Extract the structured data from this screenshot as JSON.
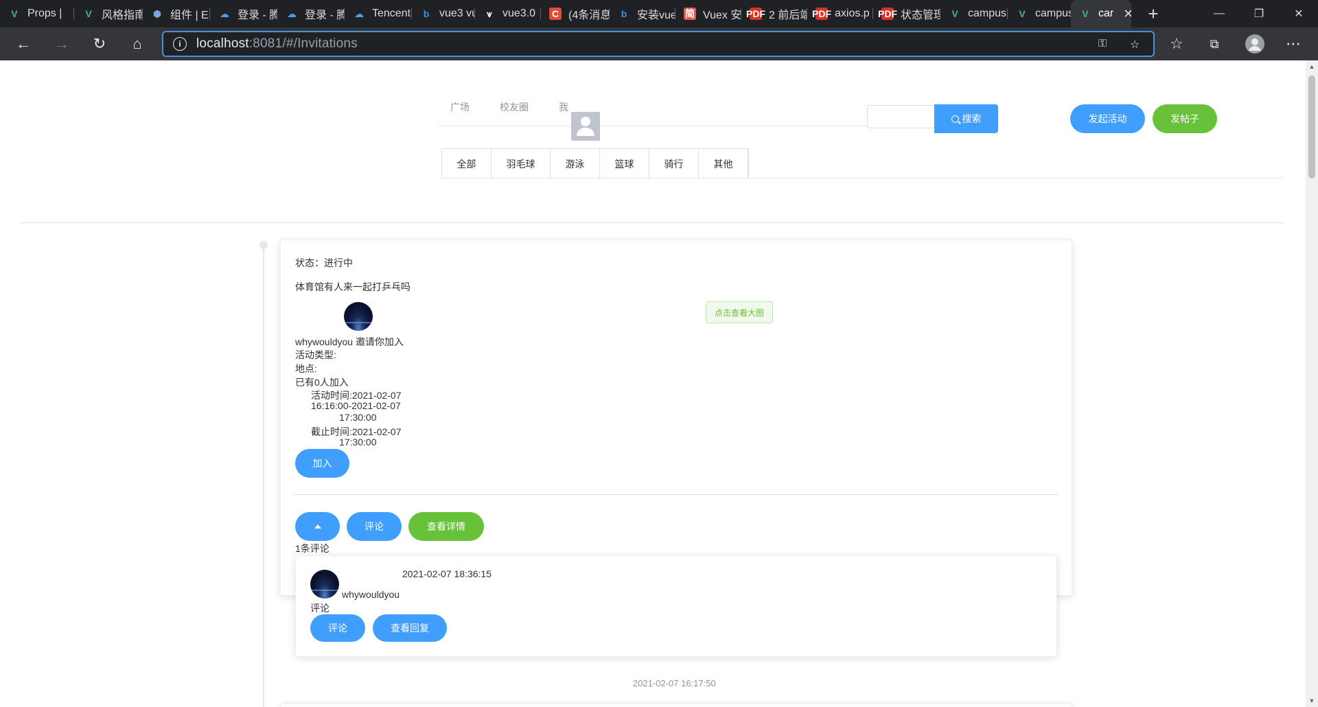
{
  "browser": {
    "tabs": [
      {
        "label": "Props |",
        "icon": "vue-logo-icon"
      },
      {
        "label": "风格指南 | E",
        "icon": "vue-logo-icon"
      },
      {
        "label": "组件 | E",
        "icon": "hexagon-icon"
      },
      {
        "label": "登录 - 腾",
        "icon": "cloud-icon"
      },
      {
        "label": "登录 - 腾",
        "icon": "cloud-icon"
      },
      {
        "label": "Tencent",
        "icon": "cloud-icon"
      },
      {
        "label": "vue3 vu",
        "icon": "bing-icon"
      },
      {
        "label": "vue3.0",
        "icon": "vs-icon"
      },
      {
        "label": "(4条消息",
        "icon": "csdn-icon"
      },
      {
        "label": "安装vue",
        "icon": "bing-icon"
      },
      {
        "label": "Vuex 安",
        "icon": "jianshu-icon"
      },
      {
        "label": "2 前后端",
        "icon": "pdf-icon"
      },
      {
        "label": "axios.p",
        "icon": "pdf-icon"
      },
      {
        "label": "状态管理",
        "icon": "pdf-icon"
      },
      {
        "label": "campus",
        "icon": "vue-logo-icon"
      },
      {
        "label": "campus",
        "icon": "vue-logo-icon"
      },
      {
        "label": "car",
        "icon": "vue-logo-icon",
        "active": true
      }
    ],
    "url_host": "localhost",
    "url_rest": ":8081/#/Invitations"
  },
  "nav": {
    "items": [
      "广场",
      "校友圈",
      "我"
    ],
    "categories": [
      "全部",
      "羽毛球",
      "游泳",
      "篮球",
      "骑行",
      "其他"
    ],
    "search_label": "搜索",
    "launch_activity": "发起活动",
    "post": "发帖子"
  },
  "card": {
    "status": "状态：进行中",
    "title": "体育馆有人来一起打乒乓吗",
    "view_image": "点击查看大图",
    "inviter": "whywouldyou 邀请你加入",
    "activity_type": "活动类型:",
    "location": "地点:",
    "joined": "已有0人加入",
    "activity_time_1": "活动时间:2021-02-07",
    "activity_time_2": "16:16:00-2021-02-07",
    "activity_time_3": "17:30:00",
    "deadline_1": "截止时间:2021-02-07",
    "deadline_2": "17:30:00",
    "join_button": "加入",
    "comment_button": "评论",
    "details_button": "查看详情",
    "comment_count": "1条评论"
  },
  "comment": {
    "time": "2021-02-07 18:36:15",
    "author": "whywouldyou",
    "text": "评论",
    "comment_button": "评论",
    "view_replies_button": "查看回复"
  },
  "post_timestamp": "2021-02-07 16:17:50",
  "colors": {
    "primary": "#409eff",
    "success": "#67c23a"
  }
}
